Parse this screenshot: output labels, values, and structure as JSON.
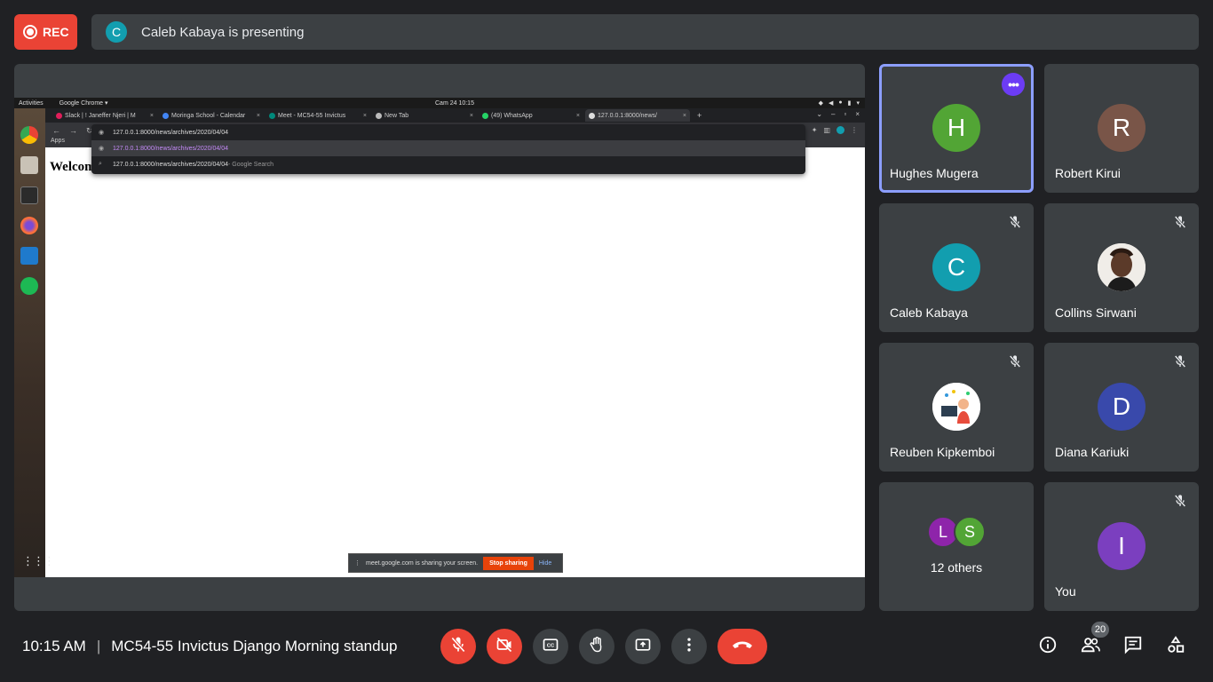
{
  "top": {
    "rec_label": "REC",
    "presenter_initial": "C",
    "presenting_text": "Caleb Kabaya is presenting"
  },
  "shared_screen": {
    "activities": "Activities",
    "app_menu": "Google Chrome ▾",
    "clock": "Cam 24  10:15",
    "tabs": [
      {
        "label": "Slack | ! Janeffer Njeri | M"
      },
      {
        "label": "Moringa School - Calendar"
      },
      {
        "label": "Meet - MC54-55 Invictus"
      },
      {
        "label": "New Tab"
      },
      {
        "label": "(49) WhatsApp"
      },
      {
        "label": "127.0.0.1:8000/news/"
      }
    ],
    "address_value": "127.0.0.1:8000/news/archives/2020/04/04",
    "suggestion_1": "127.0.0.1:8000/news/archives/2020/04/04",
    "suggestion_2": "127.0.0.1:8000/news/archives/2020/04/04",
    "suggestion_2_hint": " - Google Search",
    "bookmarks_apps": "Apps",
    "page_heading": "Welcom",
    "share_notice": "meet.google.com is sharing your screen.",
    "stop_sharing": "Stop sharing",
    "hide": "Hide"
  },
  "participants": [
    {
      "name": "Hughes Mugera",
      "initial": "H",
      "color": "#52a535"
    },
    {
      "name": "Robert Kirui",
      "initial": "R",
      "color": "#795548"
    },
    {
      "name": "Caleb Kabaya",
      "initial": "C",
      "color": "#129eaf"
    },
    {
      "name": "Collins Sirwani"
    },
    {
      "name": "Reuben Kipkemboi"
    },
    {
      "name": "Diana Kariuki",
      "initial": "D",
      "color": "#3949ab"
    },
    {
      "others_label": "12 others",
      "initial_1": "L",
      "color_1": "#8e24aa",
      "initial_2": "S",
      "color_2": "#52a535"
    },
    {
      "name": "You",
      "initial": "I",
      "color": "#7b3fbf"
    }
  ],
  "bottom": {
    "time": "10:15 AM",
    "separator": "|",
    "meeting_title": "MC54-55 Invictus Django Morning standup",
    "participant_count": "20"
  },
  "colors": {
    "background": "#202124",
    "tile": "#3c4043",
    "danger": "#ea4335",
    "active_border": "#8c9eff"
  }
}
